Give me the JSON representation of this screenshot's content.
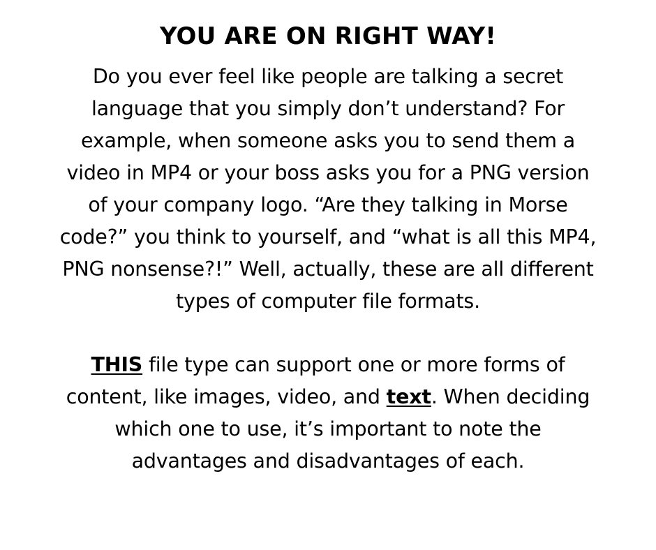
{
  "title": "YOU ARE ON RIGHT WAY!",
  "paragraph1": {
    "lines": [
      "Do you ever feel like people are talking a secret",
      "language that you simply don’t understand? For",
      "example, when someone asks you to send them a",
      "video in MP4 or your boss asks you for a PNG version",
      "of your company logo. “Are they talking in Morse",
      "code?” you think to yourself, and “what is all this MP4,",
      "PNG nonsense?!” Well, actually, these are all different",
      "types of computer file formats."
    ]
  },
  "paragraph2": {
    "line1_emphasis": "THIS",
    "line1_rest": " file type can support one or more forms of",
    "line2_start": "content, like images, video, and ",
    "line2_emphasis": "text",
    "line2_end": ". When deciding",
    "line3": "which one to use, it’s important to note the",
    "line4": "advantages and disadvantages of each."
  }
}
